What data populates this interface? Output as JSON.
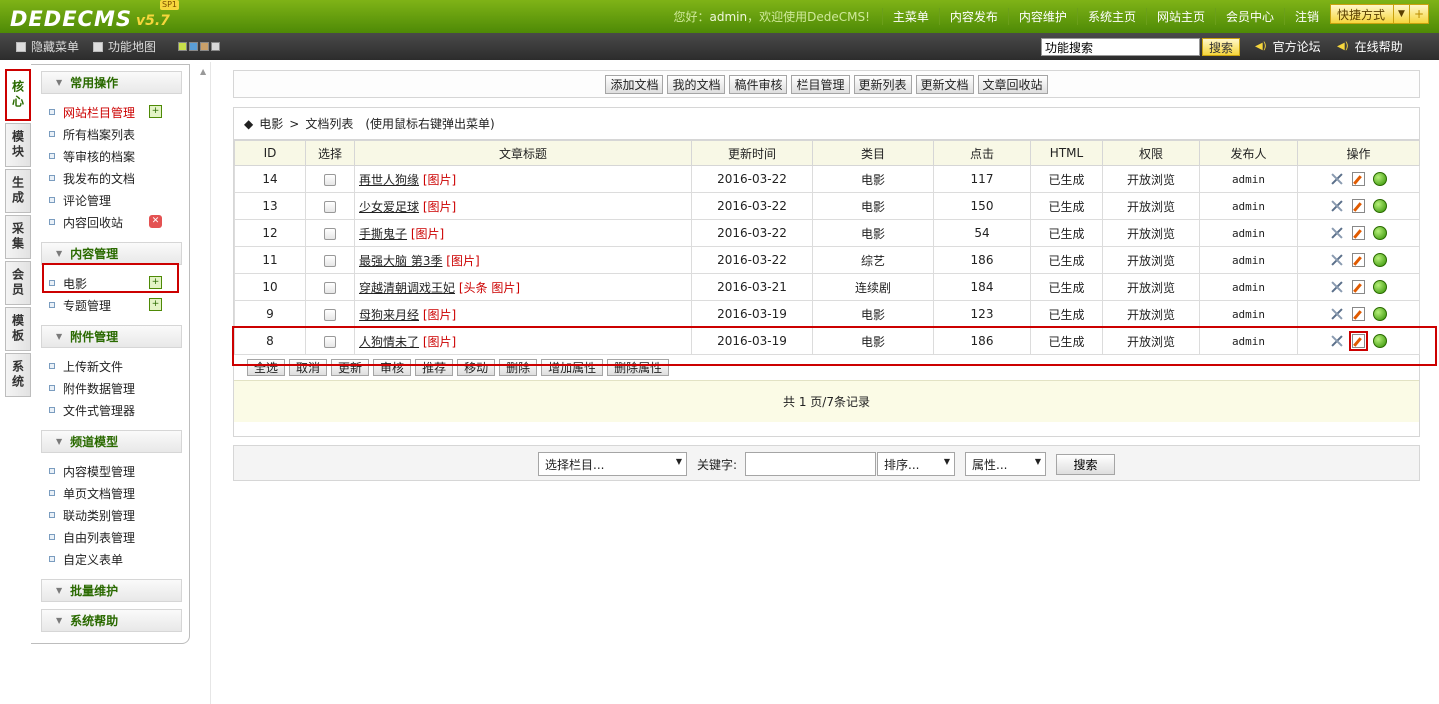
{
  "header": {
    "logo": "DEDECMS",
    "version": "v5.7",
    "edition": "SP1",
    "greeting_prefix": "您好：",
    "username": "admin",
    "greeting_suffix": "，欢迎使用DedeCMS!",
    "nav": [
      "主菜单",
      "内容发布",
      "内容维护",
      "系统主页",
      "网站主页",
      "会员中心",
      "注销"
    ],
    "quick_label": "快捷方式"
  },
  "subbar": {
    "hide_menu": "隐藏菜单",
    "func_map": "功能地图",
    "search_value": "功能搜索",
    "search_btn": "搜索",
    "forum_link": "官方论坛",
    "help_link": "在线帮助",
    "colors": [
      "#c9e04a",
      "#5a9ed6",
      "#c9a06a",
      "#d8d8d8"
    ]
  },
  "vtabs": [
    "核心",
    "模块",
    "生成",
    "采集",
    "会员",
    "模板",
    "系统"
  ],
  "menu": {
    "sec_common": "常用操作",
    "common_items": [
      "网站栏目管理",
      "所有档案列表",
      "等审核的档案",
      "我发布的文档",
      "评论管理",
      "内容回收站"
    ],
    "sec_content": "内容管理",
    "content_items": [
      "电影",
      "专题管理"
    ],
    "sec_attach": "附件管理",
    "attach_items": [
      "上传新文件",
      "附件数据管理",
      "文件式管理器"
    ],
    "sec_channel": "频道模型",
    "channel_items": [
      "内容模型管理",
      "单页文档管理",
      "联动类别管理",
      "自由列表管理",
      "自定义表单"
    ],
    "sec_batch": "批量维护",
    "sec_help": "系统帮助"
  },
  "toolbar": [
    "添加文档",
    "我的文档",
    "稿件审核",
    "栏目管理",
    "更新列表",
    "更新文档",
    "文章回收站"
  ],
  "list": {
    "crumb_icon": "◆",
    "crumb_channel": "电影",
    "crumb_sep": ">",
    "crumb_page": "文档列表",
    "crumb_hint": "(使用鼠标右键弹出菜单)",
    "columns": [
      "ID",
      "选择",
      "文章标题",
      "更新时间",
      "类目",
      "点击",
      "HTML",
      "权限",
      "发布人",
      "操作"
    ],
    "rows": [
      {
        "id": "14",
        "title": "再世人狗缘",
        "tag": "[图片]",
        "time": "2016-03-22",
        "cat": "电影",
        "clicks": "117",
        "html": "已生成",
        "perm": "开放浏览",
        "author": "admin"
      },
      {
        "id": "13",
        "title": "少女爱足球",
        "tag": "[图片]",
        "time": "2016-03-22",
        "cat": "电影",
        "clicks": "150",
        "html": "已生成",
        "perm": "开放浏览",
        "author": "admin"
      },
      {
        "id": "12",
        "title": "手撕鬼子",
        "tag": "[图片]",
        "time": "2016-03-22",
        "cat": "电影",
        "clicks": "54",
        "html": "已生成",
        "perm": "开放浏览",
        "author": "admin"
      },
      {
        "id": "11",
        "title": "最强大脑 第3季",
        "tag": "[图片]",
        "time": "2016-03-22",
        "cat": "综艺",
        "clicks": "186",
        "html": "已生成",
        "perm": "开放浏览",
        "author": "admin"
      },
      {
        "id": "10",
        "title": "穿越清朝调戏王妃",
        "tag": "[头条 图片]",
        "time": "2016-03-21",
        "cat": "连续剧",
        "clicks": "184",
        "html": "已生成",
        "perm": "开放浏览",
        "author": "admin"
      },
      {
        "id": "9",
        "title": "母狗来月经",
        "tag": "[图片]",
        "time": "2016-03-19",
        "cat": "电影",
        "clicks": "123",
        "html": "已生成",
        "perm": "开放浏览",
        "author": "admin"
      },
      {
        "id": "8",
        "title": "人狗情未了",
        "tag": "[图片]",
        "time": "2016-03-19",
        "cat": "电影",
        "clicks": "186",
        "html": "已生成",
        "perm": "开放浏览",
        "author": "admin"
      }
    ],
    "actions": [
      "全选",
      "取消",
      "更新",
      "审核",
      "推荐",
      "移动",
      "删除",
      "增加属性",
      "删除属性"
    ],
    "pager": "共 1 页/7条记录"
  },
  "filter": {
    "category_select": "选择栏目...",
    "keyword_label": "关键字:",
    "keyword_value": "",
    "order_select": "排序...",
    "attr_select": "属性...",
    "search_btn": "搜索"
  }
}
